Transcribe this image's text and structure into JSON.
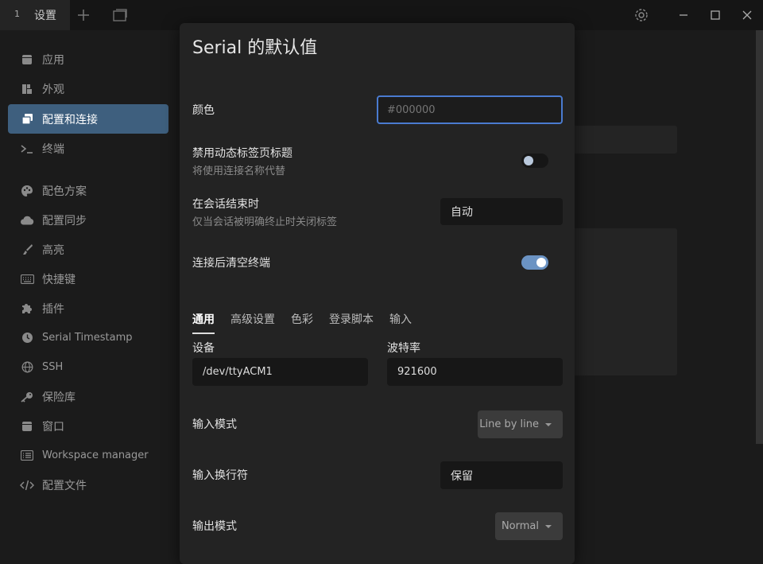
{
  "titlebar": {
    "tab_index": "1",
    "tab_title": "设置"
  },
  "sidebar": {
    "items": [
      {
        "label": "应用",
        "icon": "window-icon"
      },
      {
        "label": "外观",
        "icon": "palette-blocks-icon"
      },
      {
        "label": "配置和连接",
        "icon": "stacked-windows-icon",
        "active": true
      },
      {
        "label": "终端",
        "icon": "terminal-prompt-icon"
      },
      {
        "label": "配色方案",
        "icon": "palette-icon"
      },
      {
        "label": "配置同步",
        "icon": "cloud-icon"
      },
      {
        "label": "高亮",
        "icon": "highlighter-icon"
      },
      {
        "label": "快捷键",
        "icon": "keyboard-icon"
      },
      {
        "label": "插件",
        "icon": "puzzle-icon"
      },
      {
        "label": "Serial Timestamp",
        "icon": "clock-icon"
      },
      {
        "label": "SSH",
        "icon": "globe-icon"
      },
      {
        "label": "保险库",
        "icon": "key-icon"
      },
      {
        "label": "窗口",
        "icon": "window-icon"
      },
      {
        "label": "Workspace manager",
        "icon": "list-icon"
      },
      {
        "label": "配置文件",
        "icon": "code-icon"
      }
    ]
  },
  "modal": {
    "title": "Serial 的默认值",
    "color": {
      "label": "颜色",
      "placeholder": "#000000"
    },
    "disable_dynamic_title": {
      "label": "禁用动态标签页标题",
      "sub": "将使用连接名称代替",
      "enabled": false
    },
    "on_session_end": {
      "label": "在会话结束时",
      "sub": "仅当会话被明确终止时关闭标签",
      "value": "自动"
    },
    "clear_after_connect": {
      "label": "连接后清空终端",
      "enabled": true
    },
    "tabs": [
      "通用",
      "高级设置",
      "色彩",
      "登录脚本",
      "输入"
    ],
    "device": {
      "label": "设备",
      "value": "/dev/ttyACM1"
    },
    "baud": {
      "label": "波特率",
      "value": "921600"
    },
    "input_mode": {
      "label": "输入模式",
      "value": "Line by line"
    },
    "input_newline": {
      "label": "输入换行符",
      "value": "保留"
    },
    "output_mode": {
      "label": "输出模式",
      "value": "Normal"
    }
  }
}
